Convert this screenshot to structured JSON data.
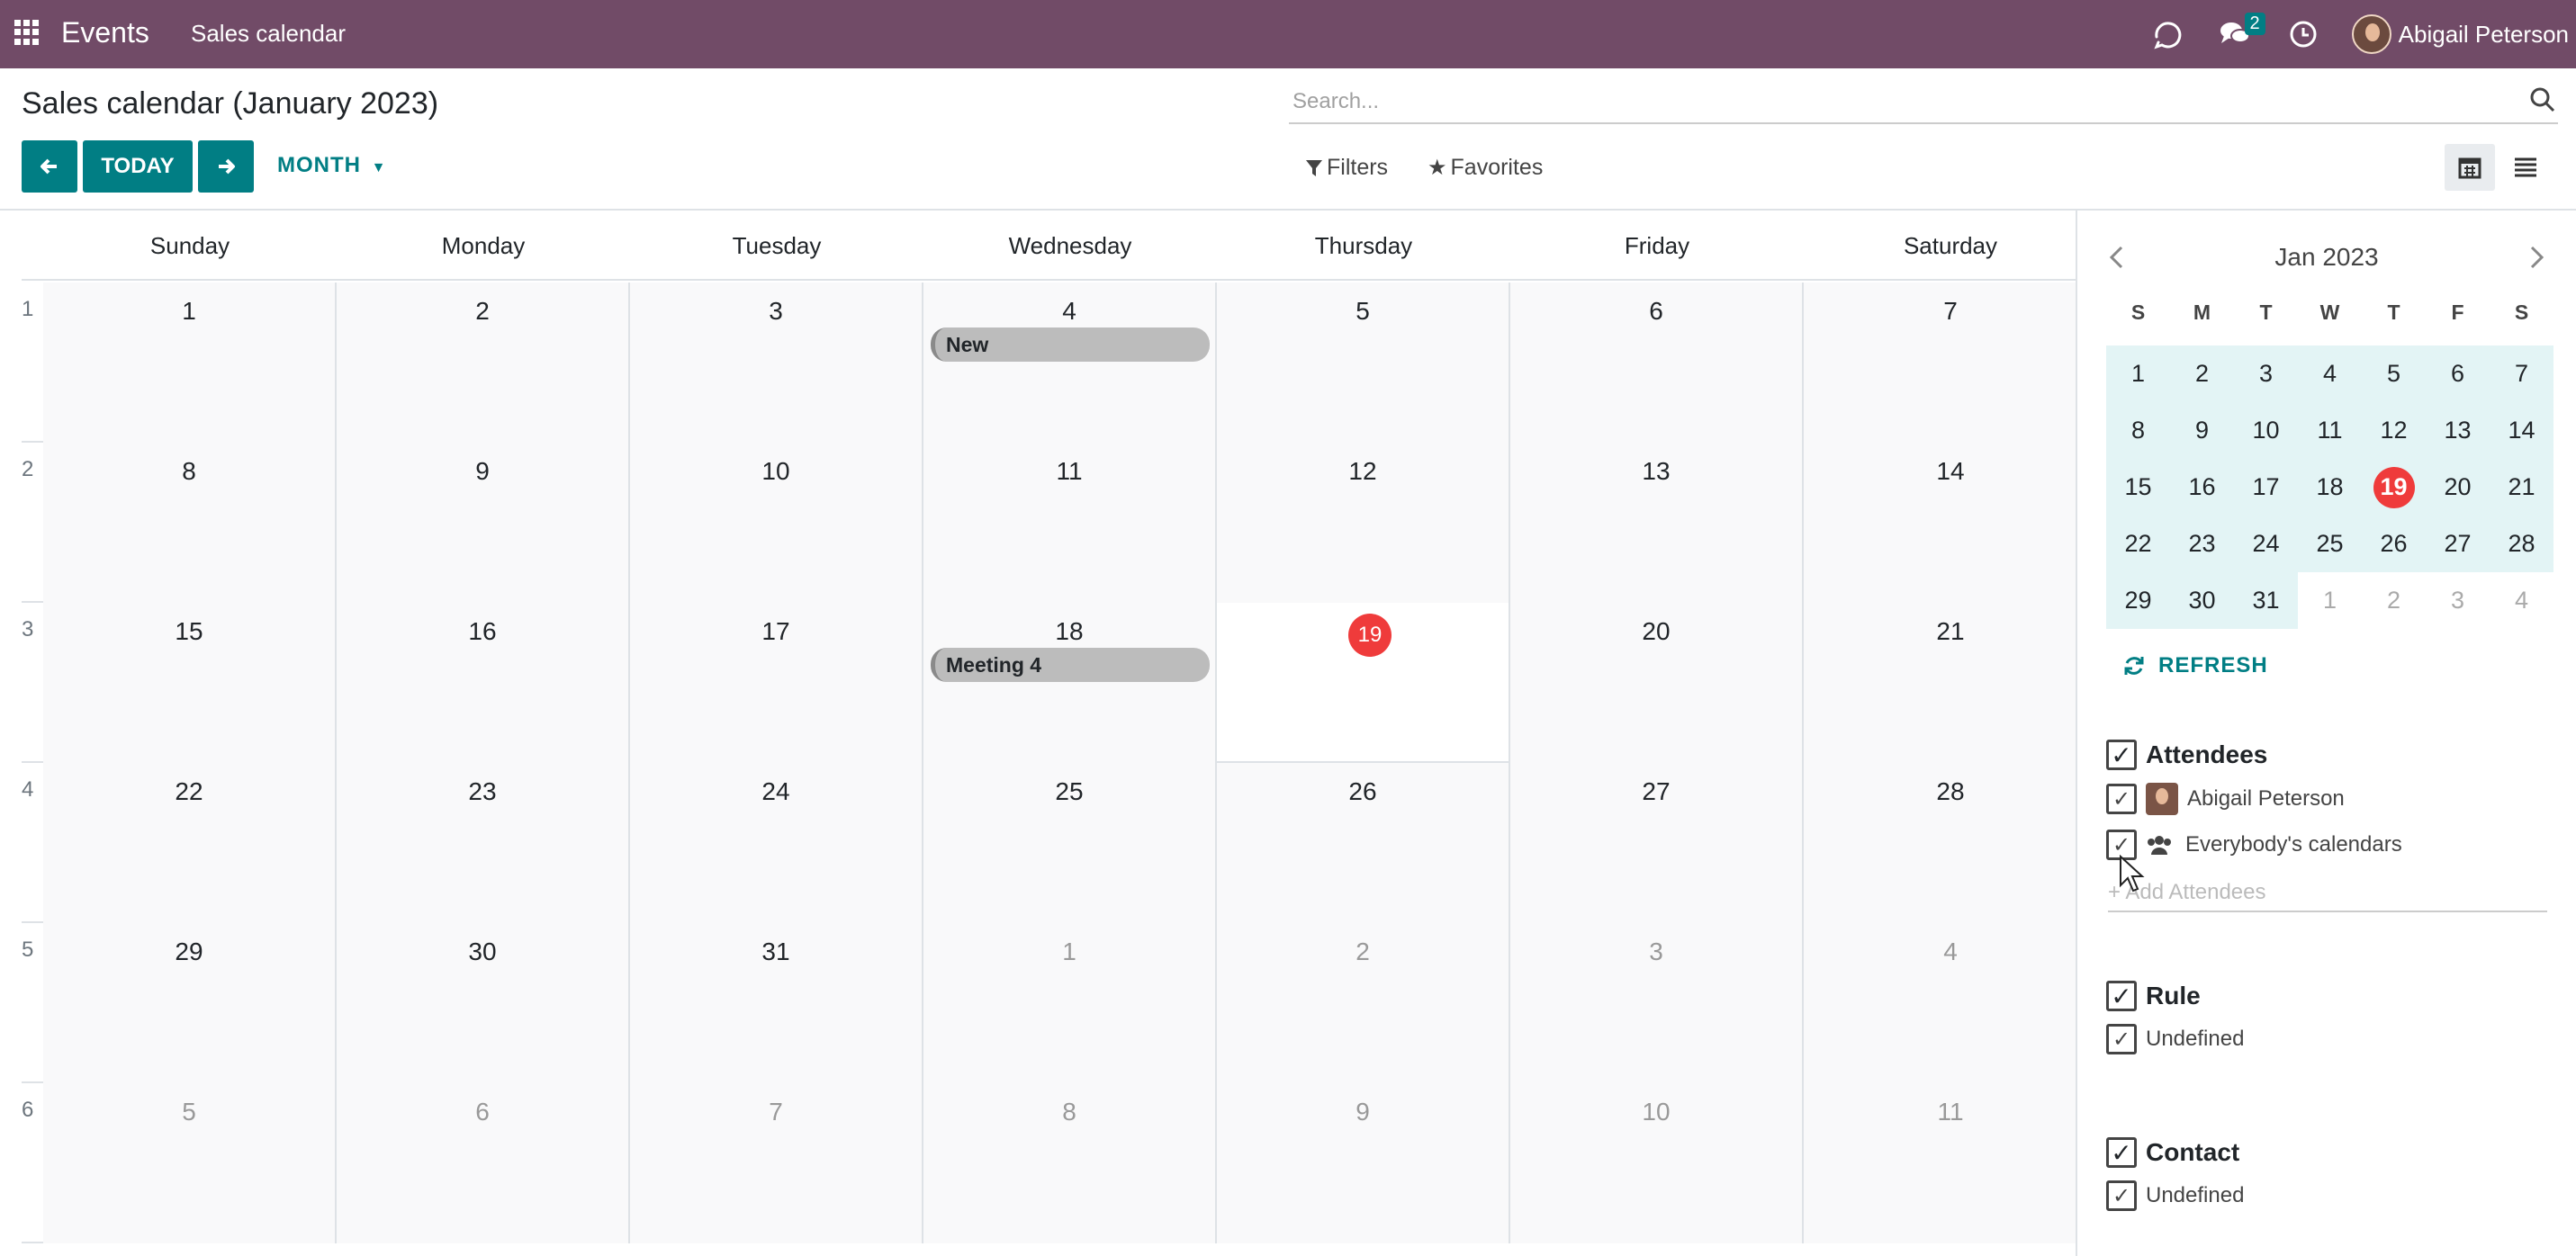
{
  "navbar": {
    "app_name": "Events",
    "menu": "Sales calendar",
    "messages_count": "2",
    "user_name": "Abigail Peterson"
  },
  "control_panel": {
    "title": "Sales calendar (January 2023)",
    "today_label": "TODAY",
    "scale_label": "MONTH",
    "search_placeholder": "Search...",
    "filters_label": "Filters",
    "favorites_label": "Favorites"
  },
  "calendar": {
    "day_names": [
      "Sunday",
      "Monday",
      "Tuesday",
      "Wednesday",
      "Thursday",
      "Friday",
      "Saturday"
    ],
    "weeks": [
      {
        "num": "1",
        "days": [
          "1",
          "2",
          "3",
          "4",
          "5",
          "6",
          "7"
        ]
      },
      {
        "num": "2",
        "days": [
          "8",
          "9",
          "10",
          "11",
          "12",
          "13",
          "14"
        ]
      },
      {
        "num": "3",
        "days": [
          "15",
          "16",
          "17",
          "18",
          "19",
          "20",
          "21"
        ]
      },
      {
        "num": "4",
        "days": [
          "22",
          "23",
          "24",
          "25",
          "26",
          "27",
          "28"
        ]
      },
      {
        "num": "5",
        "days": [
          "29",
          "30",
          "31",
          "1",
          "2",
          "3",
          "4"
        ]
      },
      {
        "num": "6",
        "days": [
          "5",
          "6",
          "7",
          "8",
          "9",
          "10",
          "11"
        ]
      }
    ],
    "events": [
      {
        "title": "New"
      },
      {
        "title": "Meeting 4"
      }
    ]
  },
  "mini_calendar": {
    "title": "Jan 2023",
    "dow": [
      "S",
      "M",
      "T",
      "W",
      "T",
      "F",
      "S"
    ],
    "weeks": [
      [
        "1",
        "2",
        "3",
        "4",
        "5",
        "6",
        "7"
      ],
      [
        "8",
        "9",
        "10",
        "11",
        "12",
        "13",
        "14"
      ],
      [
        "15",
        "16",
        "17",
        "18",
        "19",
        "20",
        "21"
      ],
      [
        "22",
        "23",
        "24",
        "25",
        "26",
        "27",
        "28"
      ],
      [
        "29",
        "30",
        "31",
        "1",
        "2",
        "3",
        "4"
      ]
    ],
    "refresh_label": "REFRESH"
  },
  "filters": {
    "attendees": {
      "title": "Attendees",
      "items": [
        "Abigail Peterson",
        "Everybody's calendars"
      ],
      "add_placeholder": "+ Add Attendees"
    },
    "rule": {
      "title": "Rule",
      "items": [
        "Undefined"
      ]
    },
    "contact": {
      "title": "Contact",
      "items": [
        "Undefined"
      ]
    }
  },
  "colors": {
    "navbar": "#714b67",
    "primary": "#017e84",
    "today": "#ef3b3b",
    "event": "#bcbcbc"
  }
}
